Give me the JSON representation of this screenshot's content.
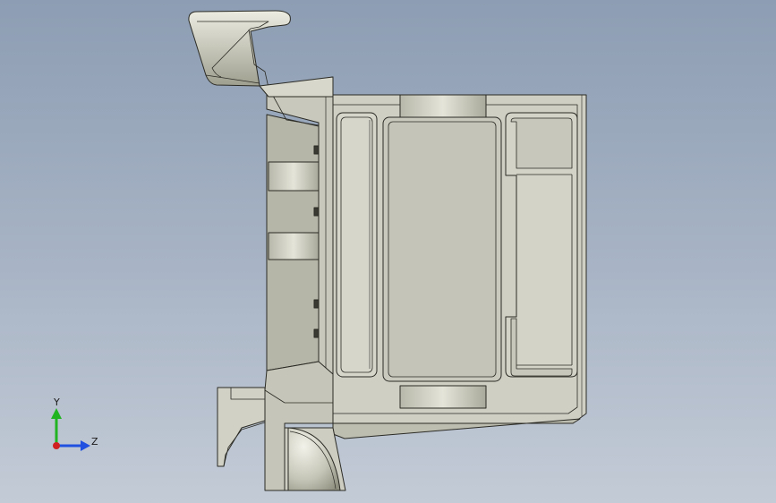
{
  "viewport": {
    "background_top": "#8d9db3",
    "background_bottom": "#c3cbd6",
    "model_fill": "#cfcfc4",
    "model_fill_dark": "#a8a89a",
    "model_edge": "#2b2b25"
  },
  "triad": {
    "y_label": "Y",
    "z_label": "Z",
    "y_color": "#21b421",
    "z_color": "#2050e0",
    "x_color": "#d02020"
  }
}
